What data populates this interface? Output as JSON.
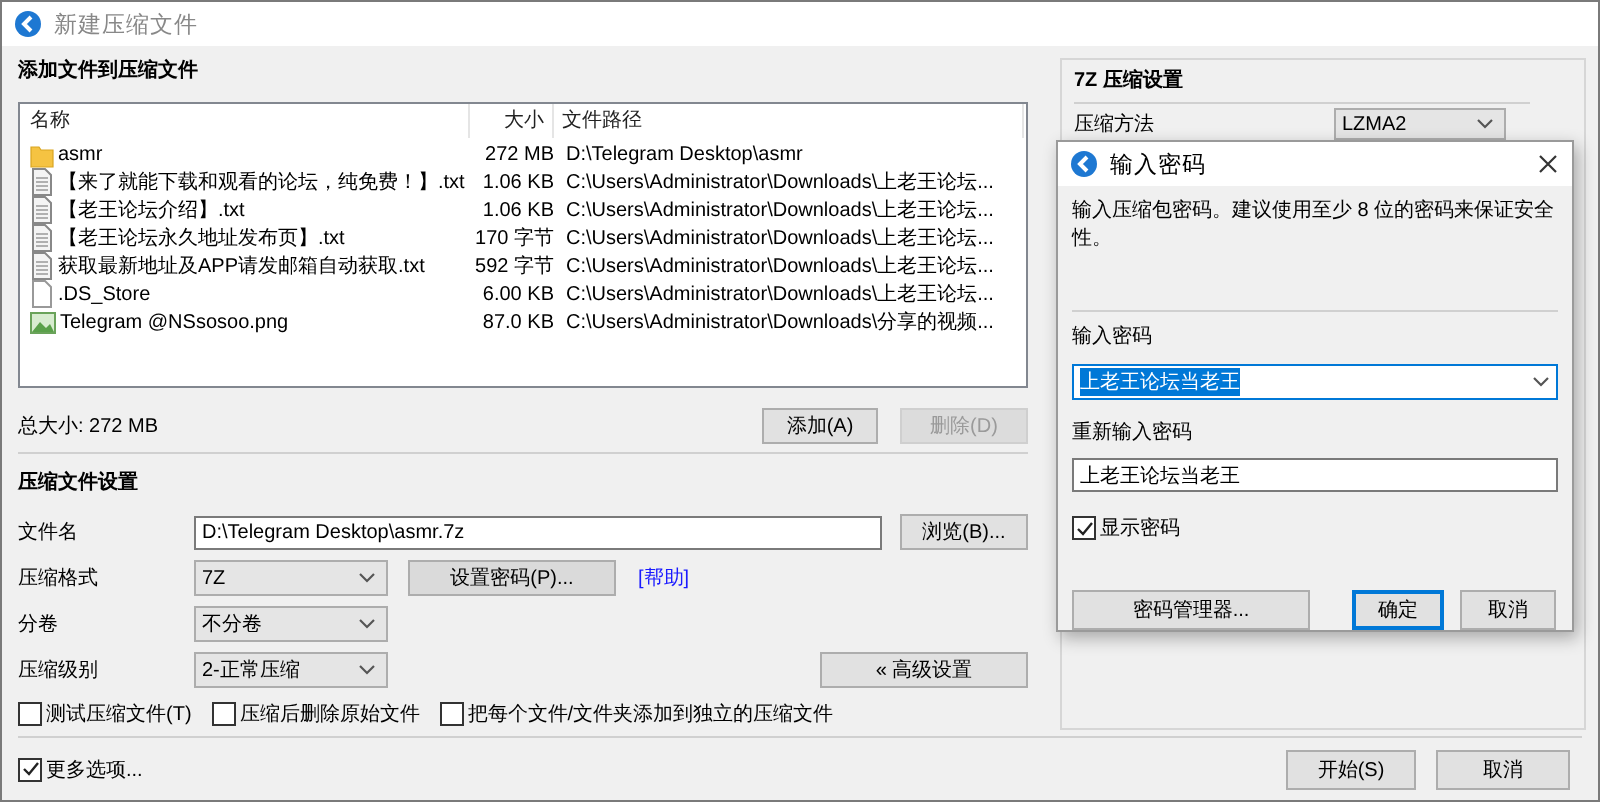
{
  "window": {
    "title": "新建压缩文件"
  },
  "files_section": {
    "title": "添加文件到压缩文件",
    "columns": [
      "名称",
      "大小",
      "文件路径"
    ],
    "rows": [
      {
        "kind": "folder",
        "name": "asmr",
        "size": "272 MB",
        "path": "D:\\Telegram Desktop\\asmr"
      },
      {
        "kind": "text",
        "name": "【来了就能下载和观看的论坛，纯免费！】.txt",
        "size": "1.06 KB",
        "path": "C:\\Users\\Administrator\\Downloads\\上老王论坛..."
      },
      {
        "kind": "text",
        "name": "【老王论坛介绍】.txt",
        "size": "1.06 KB",
        "path": "C:\\Users\\Administrator\\Downloads\\上老王论坛..."
      },
      {
        "kind": "text",
        "name": "【老王论坛永久地址发布页】.txt",
        "size": "170 字节",
        "path": "C:\\Users\\Administrator\\Downloads\\上老王论坛..."
      },
      {
        "kind": "text",
        "name": "获取最新地址及APP请发邮箱自动获取.txt",
        "size": "592 字节",
        "path": "C:\\Users\\Administrator\\Downloads\\上老王论坛..."
      },
      {
        "kind": "file",
        "name": ".DS_Store",
        "size": "6.00 KB",
        "path": "C:\\Users\\Administrator\\Downloads\\上老王论坛..."
      },
      {
        "kind": "image",
        "name": "Telegram @NSsosoo.png",
        "size": "87.0 KB",
        "path": "C:\\Users\\Administrator\\Downloads\\分享的视频..."
      }
    ],
    "total": "总大小: 272 MB",
    "buttons": [
      {
        "label": "添加(A)",
        "disabled": false
      },
      {
        "label": "删除(D)",
        "disabled": true
      }
    ]
  },
  "settings": {
    "title": "压缩文件设置",
    "filename": {
      "label": "文件名",
      "value": "D:\\Telegram Desktop\\asmr.7z",
      "button": "浏览(B)..."
    },
    "format": {
      "label": "压缩格式",
      "value": "7Z"
    },
    "password_button": "设置密码(P)...",
    "help_link": "[帮助]",
    "split": {
      "label": "分卷",
      "value": "不分卷"
    },
    "level": {
      "label": "压缩级别",
      "value": "2-正常压缩"
    },
    "advanced_button": "« 高级设置",
    "options": [
      {
        "label": "测试压缩文件(T)",
        "checked": false
      },
      {
        "label": "压缩后删除原始文件",
        "checked": false
      },
      {
        "label": "把每个文件/文件夹添加到独立的压缩文件",
        "checked": false
      }
    ]
  },
  "side_panel": {
    "title": "7Z 压缩设置",
    "method_label": "压缩方法",
    "method_value": "LZMA2"
  },
  "more_options": {
    "label": "更多选项...",
    "checked": true
  },
  "footer_buttons": [
    "开始(S)",
    "取消"
  ],
  "dialog": {
    "title": "输入密码",
    "message": "输入压缩包密码。建议使用至少 8 位的密码来保证安全性。",
    "password_label": "输入密码",
    "password_value": "上老王论坛当老王",
    "confirm_label": "重新输入密码",
    "confirm_value": "上老王论坛当老王",
    "show_password": {
      "label": "显示密码",
      "checked": true
    },
    "buttons": [
      {
        "label": "密码管理器...",
        "default": false
      },
      {
        "label": "确定",
        "default": true
      },
      {
        "label": "取消",
        "default": false
      }
    ]
  }
}
